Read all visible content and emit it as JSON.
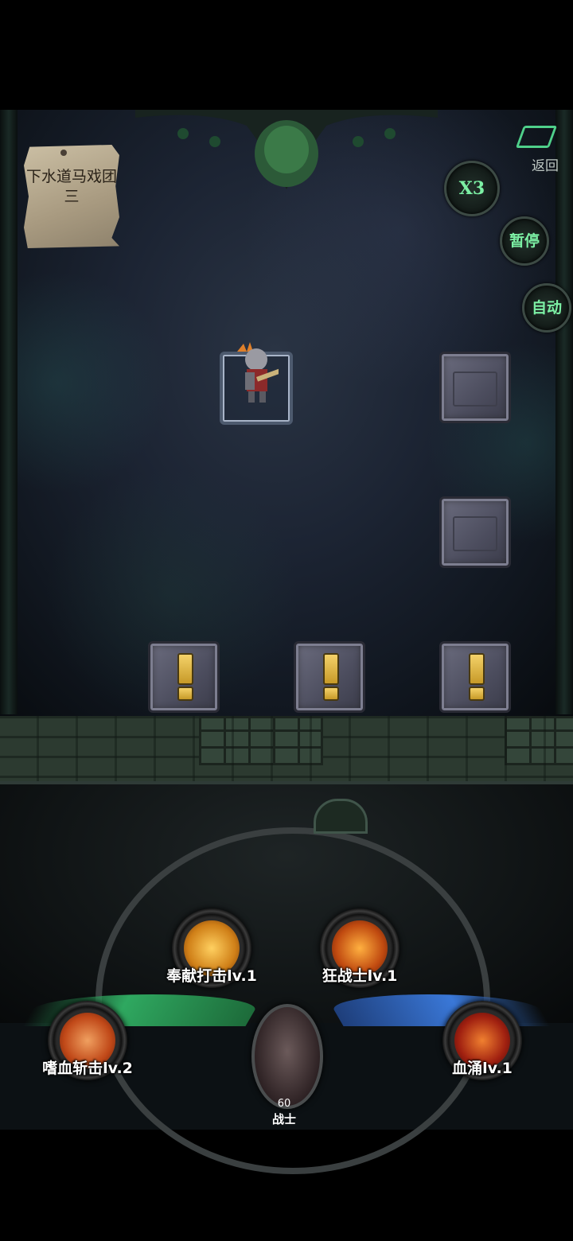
{
  "level": {
    "title": "下水道马戏团三"
  },
  "controls": {
    "back_label": "返回",
    "speed_label": "X3",
    "pause_label": "暂停",
    "auto_label": "自动"
  },
  "skills": [
    {
      "label": "奉献打击lv.1",
      "icon": "dedication-strike-icon",
      "color": "#e0a020"
    },
    {
      "label": "狂战士lv.1",
      "icon": "berserker-icon",
      "color": "#d05a18"
    },
    {
      "label": "嗜血斩击lv.2",
      "icon": "bloodthirst-slash-icon",
      "color": "#c8501c"
    },
    {
      "label": "血涌lv.1",
      "icon": "blood-surge-icon",
      "color": "#a02818"
    }
  ],
  "hero": {
    "level": "60",
    "class": "战士"
  }
}
